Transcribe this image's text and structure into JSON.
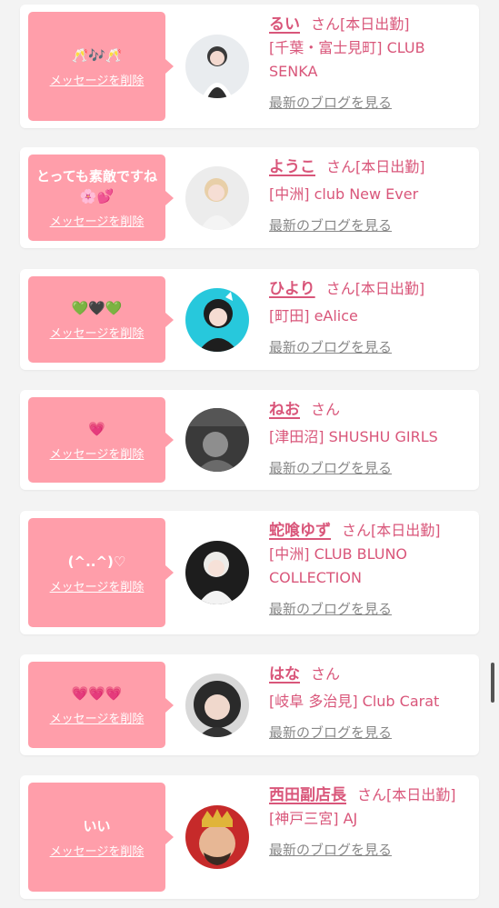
{
  "delete_label": "メッセージを削除",
  "blog_label": "最新のブログを見る",
  "honorific": "さん",
  "cards": [
    {
      "message": "🥂🎶🥂",
      "name": "るい",
      "status": "[本日出勤]",
      "shop": "[千葉・富士見町] CLUB SENKA"
    },
    {
      "message": "とっても素敵ですね🌸💕",
      "name": "ようこ",
      "status": "[本日出勤]",
      "shop": "[中洲] club New Ever"
    },
    {
      "message": "💚🖤💚",
      "name": "ひより",
      "status": "[本日出勤]",
      "shop": "[町田] eAlice"
    },
    {
      "message": "💗",
      "name": "ねお",
      "status": "",
      "shop": "[津田沼] SHUSHU GIRLS"
    },
    {
      "message": "(^..^)♡",
      "name": "蛇喰ゆず",
      "status": "[本日出勤]",
      "shop": "[中洲] CLUB BLUNO COLLECTION"
    },
    {
      "message": "💗💗💗",
      "name": "はな",
      "status": "",
      "shop": "[岐阜 多治見] Club Carat"
    },
    {
      "message": "いい",
      "name": "西田副店長",
      "status": "[本日出勤]",
      "shop": "[神戸三宮] AJ"
    }
  ],
  "colors": {
    "bubble": "#ff9eaa",
    "accent": "#d9567a",
    "link_gray": "#888888"
  }
}
